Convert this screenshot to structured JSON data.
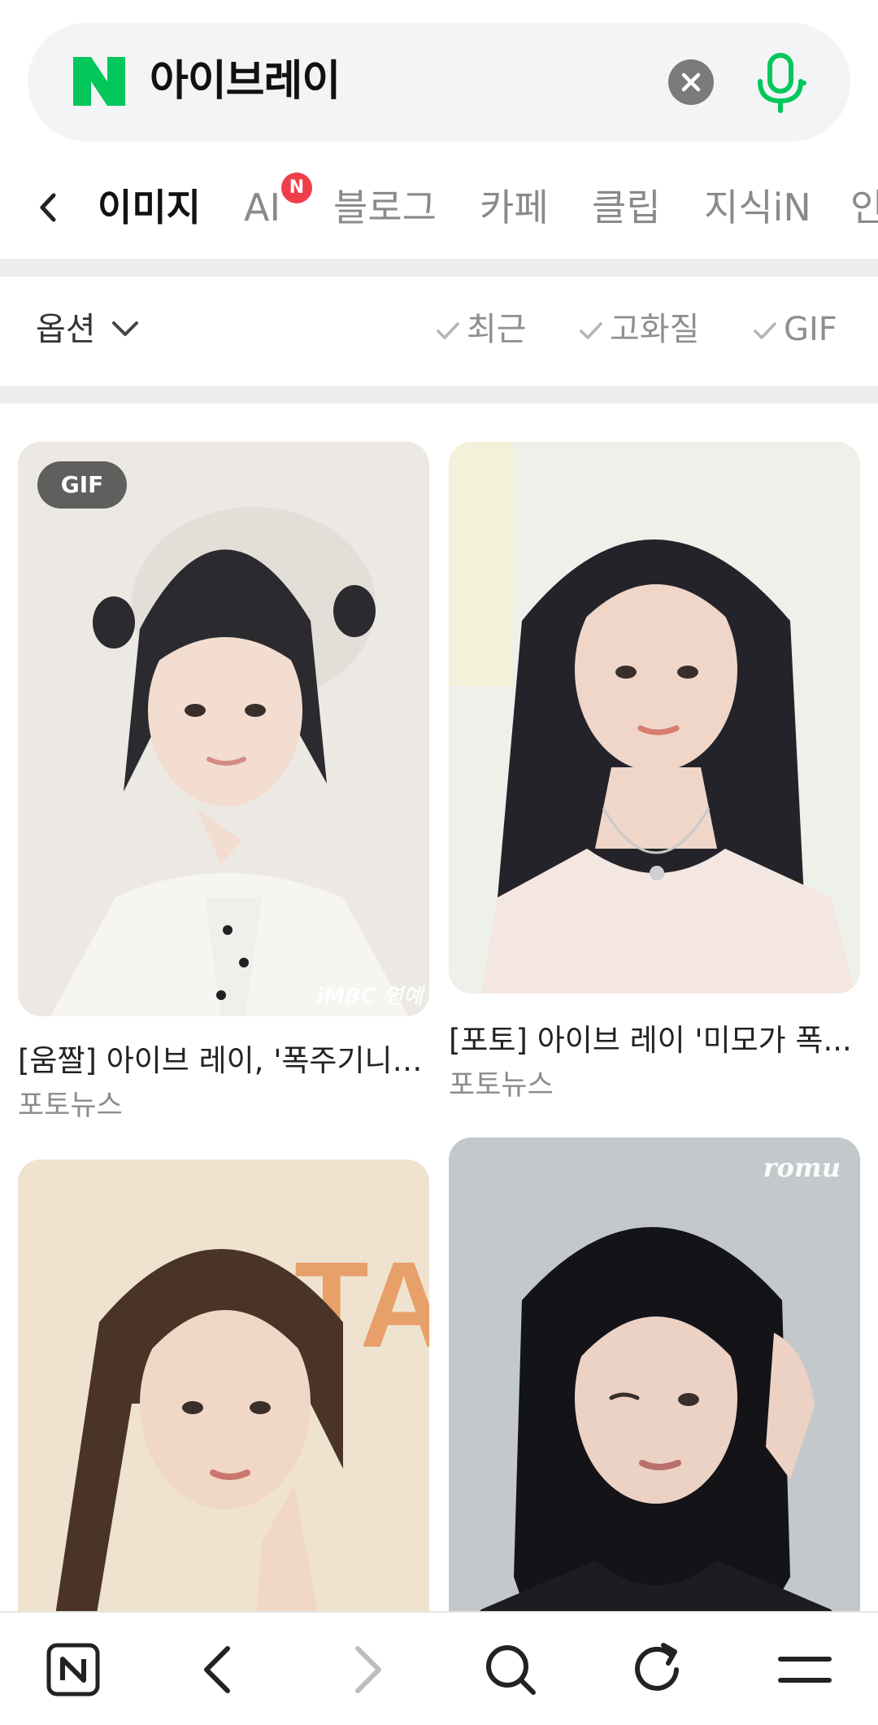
{
  "search": {
    "query": "아이브레이",
    "logo_letter": "N"
  },
  "tabs": {
    "items": [
      {
        "label": "이미지",
        "active": true
      },
      {
        "label": "AI",
        "active": false,
        "badge": "N"
      },
      {
        "label": "블로그",
        "active": false
      },
      {
        "label": "카페",
        "active": false
      },
      {
        "label": "클립",
        "active": false
      },
      {
        "label": "지식iN",
        "active": false
      },
      {
        "label": "인",
        "active": false
      }
    ]
  },
  "options": {
    "label": "옵션",
    "filters": [
      "최근",
      "고화질",
      "GIF"
    ]
  },
  "results": [
    {
      "title": "[움짤] 아이브 레이, '폭주기니' ...",
      "source": "포토뉴스",
      "badge": "GIF",
      "watermark": "iMBC 연예"
    },
    {
      "title": "[포토] 아이브 레이 '미모가 폭...",
      "source": "포토뉴스"
    },
    {
      "title": "",
      "source": ""
    },
    {
      "title": "",
      "source": "",
      "watermark": "romu"
    }
  ],
  "colors": {
    "brand_green": "#03c75a",
    "badge_red": "#ef3d4a",
    "search_bg": "#f3f4f6"
  },
  "icons": {
    "clear": "close-icon",
    "mic": "mic-icon",
    "back": "chevron-left-icon",
    "options": "chevron-down-icon",
    "check": "check-icon",
    "nav": [
      "naver-home-icon",
      "back-arrow-icon",
      "forward-arrow-icon",
      "search-icon",
      "refresh-icon",
      "menu-icon"
    ]
  }
}
